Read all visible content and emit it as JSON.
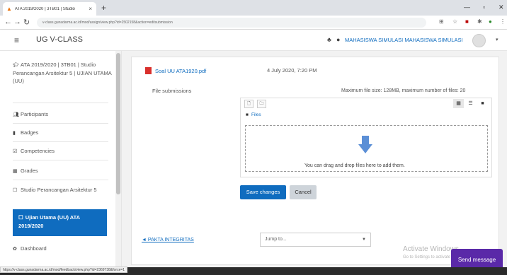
{
  "browser": {
    "tab_title": "ATA 2019/2020 | 3TB01 | Studio",
    "tab_close": "×",
    "new_tab": "+",
    "url": "v-class.gunadarma.ac.id/mod/assign/view.php?id=2502158&action=editsubmission",
    "status_url": "https://v-class.gunadarma.ac.id/mod/feedback/view.php?id=2369738&force=1",
    "icons": [
      "back-icon",
      "forward-icon",
      "reload-icon",
      "star-icon",
      "extensions-icon",
      "menu-icon"
    ]
  },
  "header": {
    "site_name": "UG V-CLASS",
    "user_name": "MAHASISWA SIMULASI MAHASISWA SIMULASI",
    "icons": [
      "hamburger-icon",
      "bell-icon",
      "chat-icon"
    ]
  },
  "sidebar": {
    "course_title": "ATA 2019/2020 | 3TB01 | Studio Perancangan Arsitektur 5 | UJIAN UTAMA (UU)",
    "items": [
      {
        "label": "Participants",
        "icon": "users-icon"
      },
      {
        "label": "Badges",
        "icon": "badge-icon"
      },
      {
        "label": "Competencies",
        "icon": "check-square-icon"
      },
      {
        "label": "Grades",
        "icon": "table-icon"
      },
      {
        "label": "Studio Perancangan Arsitektur 5",
        "icon": "folder-icon"
      },
      {
        "label": "Ujian Utama (UU) ATA 2019/2020",
        "icon": "folder-icon"
      },
      {
        "label": "Dashboard",
        "icon": "dashboard-icon"
      }
    ]
  },
  "main": {
    "file_link": "Soal UU ATA1920.pdf",
    "file_date": "4 July 2020, 7:20 PM",
    "file_submissions_label": "File submissions",
    "max_size_text": "Maximum file size: 128MB, maximum number of files: 20",
    "folder_label": "Files",
    "drop_text": "You can drag and drop files here to add them.",
    "save_label": "Save changes",
    "cancel_label": "Cancel",
    "prev_link": "◄ PAKTA INTEGRITAS",
    "jump_placeholder": "Jump to...",
    "send_message": "Send message"
  },
  "watermark": {
    "line1": "Activate Windows",
    "line2": "Go to Settings to activate Windows."
  },
  "colors": {
    "accent": "#0f6cbf",
    "send_message": "#5a29a8",
    "pdf_icon": "#d9302c",
    "drop_arrow": "#5b8fd6"
  }
}
